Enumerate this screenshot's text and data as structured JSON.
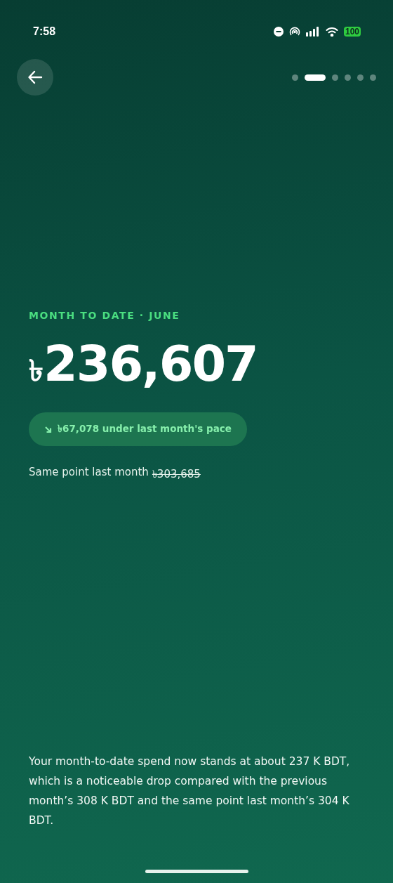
{
  "status_bar": {
    "time": "7:58",
    "battery": "100"
  },
  "nav": {
    "pages": [
      {
        "selected": false
      },
      {
        "selected": true
      },
      {
        "selected": false
      },
      {
        "selected": false
      },
      {
        "selected": false
      },
      {
        "selected": false
      }
    ]
  },
  "eyebrow": "MONTH TO DATE · JUNE",
  "amount": {
    "currency": "৳",
    "value": "236,607"
  },
  "pace_badge": {
    "down": true,
    "text": "৳67,078 under last month's pace"
  },
  "comparison": {
    "label": "Same point last month",
    "value": "৳303,685",
    "struck": true
  },
  "summary": "Your month-to-date spend now stands at about 237 K BDT, which is a noticeable drop compared with the previous month’s 308 K BDT and the same point last month’s 304 K BDT."
}
